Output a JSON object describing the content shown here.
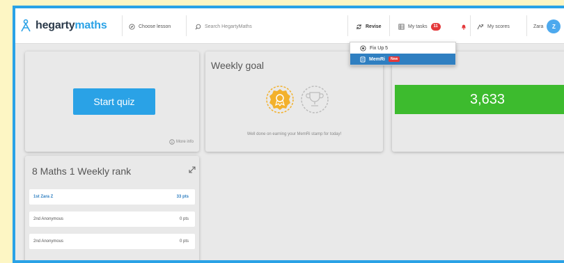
{
  "brand": {
    "name_part1": "hegarty",
    "name_part2": "maths"
  },
  "nav": {
    "choose_lesson": "Choose lesson",
    "search_placeholder": "Search HegartyMaths",
    "revise": "Revise",
    "my_tasks": "My tasks",
    "tasks_count": "11",
    "my_scores": "My scores",
    "user_name": "Zara",
    "avatar_initial": "Z"
  },
  "revise_menu": {
    "items": [
      {
        "label": "Fix Up 5",
        "icon": "fixup-icon",
        "active": false
      },
      {
        "label": "MemRi",
        "icon": "memri-icon",
        "active": true,
        "badge": "New"
      }
    ]
  },
  "quiz_card": {
    "button_label": "Start quiz",
    "more_info": "More info"
  },
  "weekly_goal": {
    "title": "Weekly goal",
    "message": "Well done on earning your MemRi stamp for today!",
    "icons": [
      "memri-stamp-icon",
      "trophy-icon"
    ]
  },
  "score_card": {
    "value": "3,633"
  },
  "rank_card": {
    "title": "8 Maths 1 Weekly rank",
    "rows": [
      {
        "name": "1st Zara Z",
        "points": "33 pts",
        "is_me": true
      },
      {
        "name": "2nd Anonymous",
        "points": "0 pts",
        "is_me": false
      },
      {
        "name": "2nd Anonymous",
        "points": "0 pts",
        "is_me": false
      }
    ]
  },
  "colors": {
    "brand_blue": "#2aa2e6",
    "score_green": "#3dbb2e",
    "badge_red": "#e4383a",
    "page_background": "#fdf6c4"
  }
}
